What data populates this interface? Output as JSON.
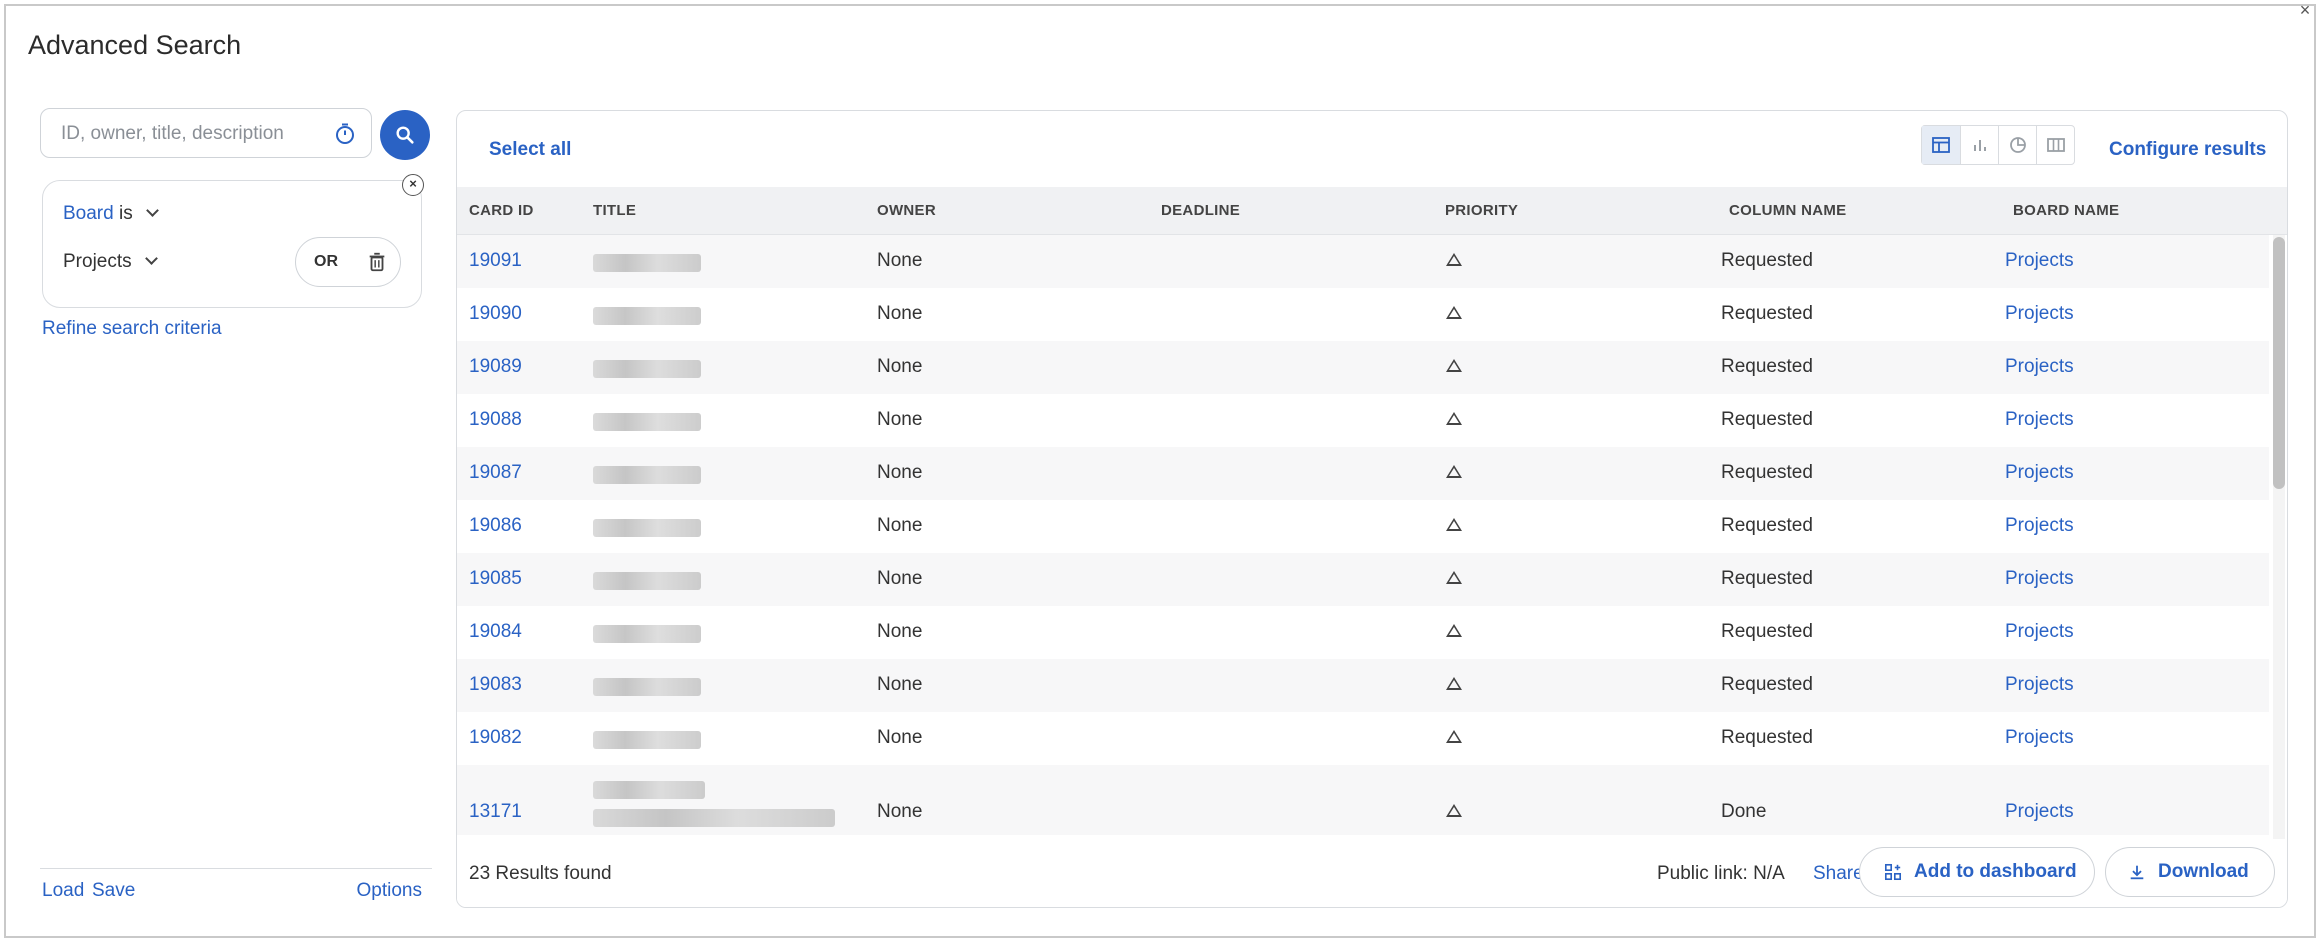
{
  "modal": {
    "title": "Advanced Search"
  },
  "search": {
    "placeholder": "ID, owner, title, description"
  },
  "filter": {
    "field_label": "Board",
    "operator": "is",
    "value": "Projects",
    "logic": "OR"
  },
  "refine_label": "Refine search criteria",
  "left_footer": {
    "load": "Load",
    "save": "Save",
    "options": "Options"
  },
  "results": {
    "select_all": "Select all",
    "configure": "Configure results",
    "columns": [
      "CARD ID",
      "TITLE",
      "OWNER",
      "DEADLINE",
      "PRIORITY",
      "COLUMN NAME",
      "BOARD NAME"
    ],
    "rows": [
      {
        "id": "19091",
        "owner": "None",
        "column": "Requested",
        "board": "Projects"
      },
      {
        "id": "19090",
        "owner": "None",
        "column": "Requested",
        "board": "Projects"
      },
      {
        "id": "19089",
        "owner": "None",
        "column": "Requested",
        "board": "Projects"
      },
      {
        "id": "19088",
        "owner": "None",
        "column": "Requested",
        "board": "Projects"
      },
      {
        "id": "19087",
        "owner": "None",
        "column": "Requested",
        "board": "Projects"
      },
      {
        "id": "19086",
        "owner": "None",
        "column": "Requested",
        "board": "Projects"
      },
      {
        "id": "19085",
        "owner": "None",
        "column": "Requested",
        "board": "Projects"
      },
      {
        "id": "19084",
        "owner": "None",
        "column": "Requested",
        "board": "Projects"
      },
      {
        "id": "19083",
        "owner": "None",
        "column": "Requested",
        "board": "Projects"
      },
      {
        "id": "19082",
        "owner": "None",
        "column": "Requested",
        "board": "Projects"
      },
      {
        "id": "13171",
        "owner": "None",
        "column": "Done",
        "board": "Projects"
      }
    ],
    "count": "23 Results found",
    "public_link": "Public link: N/A",
    "share": "Share",
    "add_dashboard": "Add to dashboard",
    "download": "Download"
  },
  "icons": {
    "search": "search-icon",
    "timer": "timer-icon",
    "trash": "trash-icon",
    "close": "close-icon",
    "priority": "triangle-outline-icon"
  },
  "colors": {
    "accent": "#2a62c4",
    "header_bg": "#f0f1f3"
  }
}
